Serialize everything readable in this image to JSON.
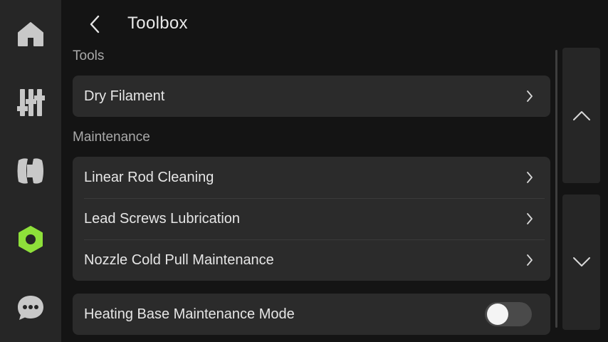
{
  "header": {
    "title": "Toolbox",
    "back_icon": "chevron-left-icon"
  },
  "sidebar": {
    "items": [
      {
        "icon": "home-icon",
        "active": false
      },
      {
        "icon": "sliders-icon",
        "active": false
      },
      {
        "icon": "filament-spool-icon",
        "active": false
      },
      {
        "icon": "hex-nut-icon",
        "active": true
      },
      {
        "icon": "chat-bubble-icon",
        "active": false
      }
    ],
    "active_color": "#8ee03a",
    "icon_color": "#c8c8c8"
  },
  "sections": {
    "tools": {
      "title": "Tools",
      "items": [
        {
          "label": "Dry Filament"
        }
      ]
    },
    "maintenance": {
      "title": "Maintenance",
      "items": [
        {
          "label": "Linear Rod Cleaning"
        },
        {
          "label": "Lead Screws Lubrication"
        },
        {
          "label": "Nozzle Cold Pull Maintenance"
        }
      ]
    },
    "settings": {
      "items": [
        {
          "label": "Heating Base Maintenance Mode",
          "toggle_on": false
        }
      ]
    }
  },
  "pager": {
    "up_icon": "chevron-up-icon",
    "down_icon": "chevron-down-icon"
  },
  "colors": {
    "background": "#141414",
    "panel": "#2b2b2b",
    "sidebar": "#262626",
    "accent": "#8ee03a"
  }
}
